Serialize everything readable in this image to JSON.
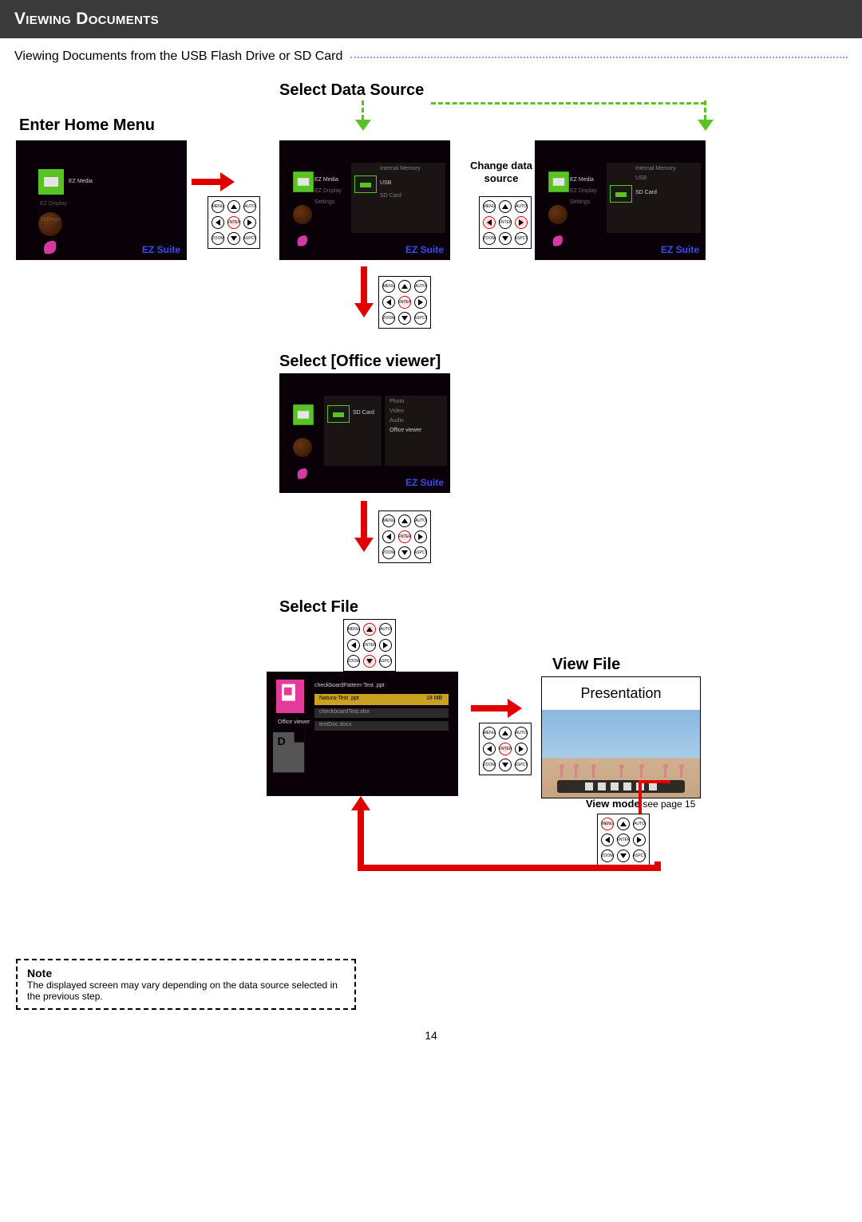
{
  "header": "Viewing Documents",
  "subtitle": "Viewing Documents from the USB Flash Drive or SD Card",
  "labels": {
    "enter_home": "Enter Home Menu",
    "select_data_source": "Select Data Source",
    "change_data_source": "Change data\nsource",
    "select_office_viewer": "Select [Office viewer]",
    "select_file": "Select File",
    "view_file": "View File",
    "presentation": "Presentation",
    "view_mode": "View mode",
    "view_mode_ref": "see page 15"
  },
  "ezsuite": "EZ Suite",
  "menu": {
    "ez_media": "EZ Media",
    "ez_display": "EZ Display",
    "settings": "Settings",
    "internal_memory": "Internal Memory",
    "usb": "USB",
    "sd_card": "SD Card",
    "office_viewer": "Office viewer",
    "photo": "Photo",
    "video": "Video",
    "audio": "Audio"
  },
  "remote": {
    "menu": "MENU",
    "auto": "AUTO",
    "enter": "ENTER",
    "zoom": "ZOOM",
    "aspect": "ASPCT"
  },
  "files": {
    "header": "checkboardPattern-Test .ppt",
    "row1_name": "Natura-Test .ppt",
    "row1_size": "18  MB",
    "row2_name": "checkboardTest.xlsx",
    "row3_name": "textDoc.docx",
    "label": "Office viewer"
  },
  "note": {
    "title": "Note",
    "body": "The displayed screen may vary depending on the data source selected in the previous step."
  },
  "page_number": "14"
}
